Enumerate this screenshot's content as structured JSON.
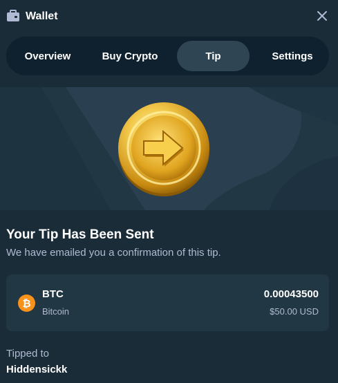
{
  "window": {
    "title": "Wallet",
    "icon": "wallet-icon",
    "close_icon": "close-icon"
  },
  "tabs": [
    {
      "label": "Overview",
      "active": false
    },
    {
      "label": "Buy Crypto",
      "active": false
    },
    {
      "label": "Tip",
      "active": true
    },
    {
      "label": "Settings",
      "active": false
    }
  ],
  "banner": {
    "image": "gold-coin-arrow-icon"
  },
  "confirmation": {
    "heading": "Your Tip Has Been Sent",
    "message": "We have emailed you a confirmation of this tip."
  },
  "tip": {
    "currency_icon": "bitcoin-icon",
    "ticker": "BTC",
    "currency_name": "Bitcoin",
    "amount": "0.00043500",
    "usd_value": "$50.00 USD"
  },
  "recipient": {
    "label": "Tipped to",
    "username": "Hiddensickk"
  },
  "colors": {
    "background": "#1a2c38",
    "tab_bar": "#0f212e",
    "active_tab": "#2f4553",
    "card": "#213743",
    "muted_text": "#b1bad3",
    "bitcoin_orange": "#f7931a",
    "gold": "#f2c94c"
  }
}
